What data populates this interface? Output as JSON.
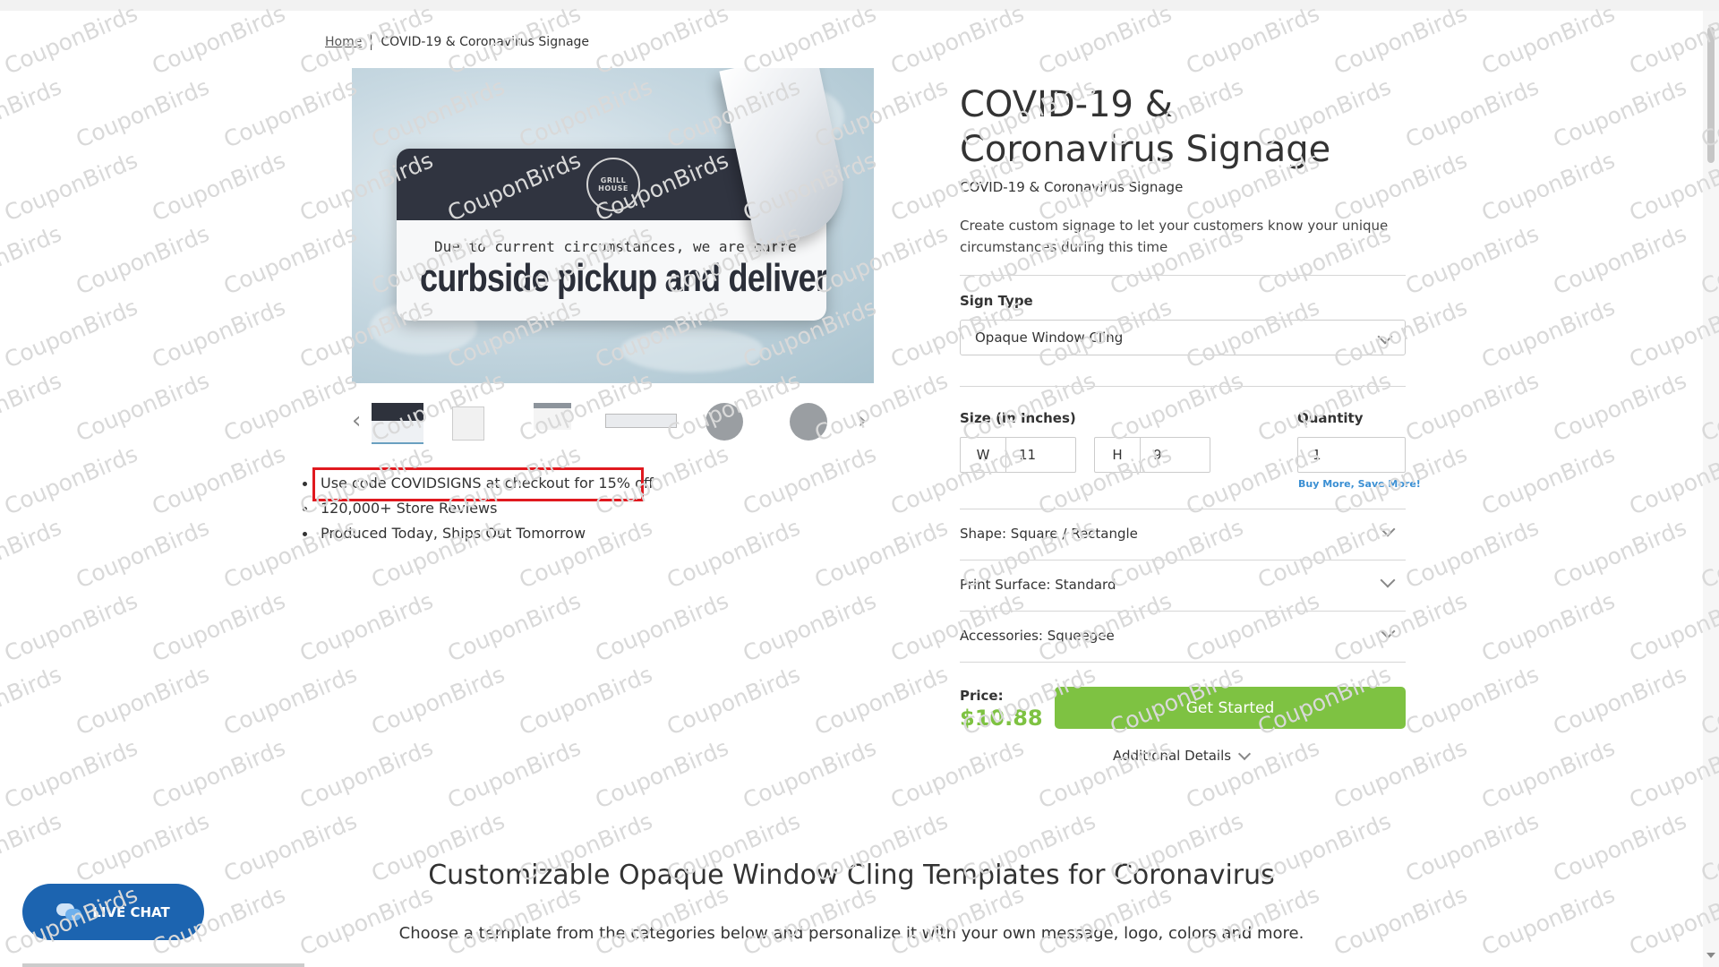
{
  "breadcrumb": {
    "home": "Home",
    "current": "COVID-19 & Coronavirus Signage"
  },
  "hero": {
    "sign_line1": "Due to current circumstances, we are curre",
    "sign_line2": "curbside pickup and delivery",
    "logo_text": "GRILL HOUSE"
  },
  "gallery": {
    "prev_icon": "chevron-left-icon",
    "next_icon": "chevron-right-icon"
  },
  "bullets": [
    "Use code COVIDSIGNS at checkout for 15% off",
    "120,000+ Store Reviews",
    "Produced Today, Ships Out Tomorrow"
  ],
  "product": {
    "title": "COVID-19 & Coronavirus Signage",
    "subtitle": "COVID-19 & Coronavirus Signage",
    "description": "Create custom signage to let your customers know your unique circumstances during this time"
  },
  "options": {
    "sign_type_label": "Sign Type",
    "sign_type_value": "Opaque Window Cling",
    "size_label": "Size (in Inches)",
    "width_prefix": "W",
    "width_value": "11",
    "height_prefix": "H",
    "height_value": "9",
    "quantity_label": "Quantity",
    "quantity_value": "1",
    "buy_more": "Buy More, Save More!",
    "shape": "Shape: Square / Rectangle",
    "print_surface": "Print Surface: Standard",
    "accessories": "Accessories: Squeegee"
  },
  "pricing": {
    "label": "Price:",
    "value": "$10.88",
    "cta": "Get Started",
    "additional": "Additional Details"
  },
  "section": {
    "title": "Customizable Opaque Window Cling Templates for Coronavirus",
    "subtitle": "Choose a template from the categories below and personalize it with your own message, logo, colors and more."
  },
  "live_chat": {
    "label": "LIVE CHAT",
    "icon": "chat-bubbles-icon"
  },
  "watermark": "CouponBirds",
  "colors": {
    "accent_green": "#7ec242",
    "promo_border": "#e0191f",
    "chat_blue": "#1c64b0",
    "link_blue": "#3a8fd3"
  }
}
